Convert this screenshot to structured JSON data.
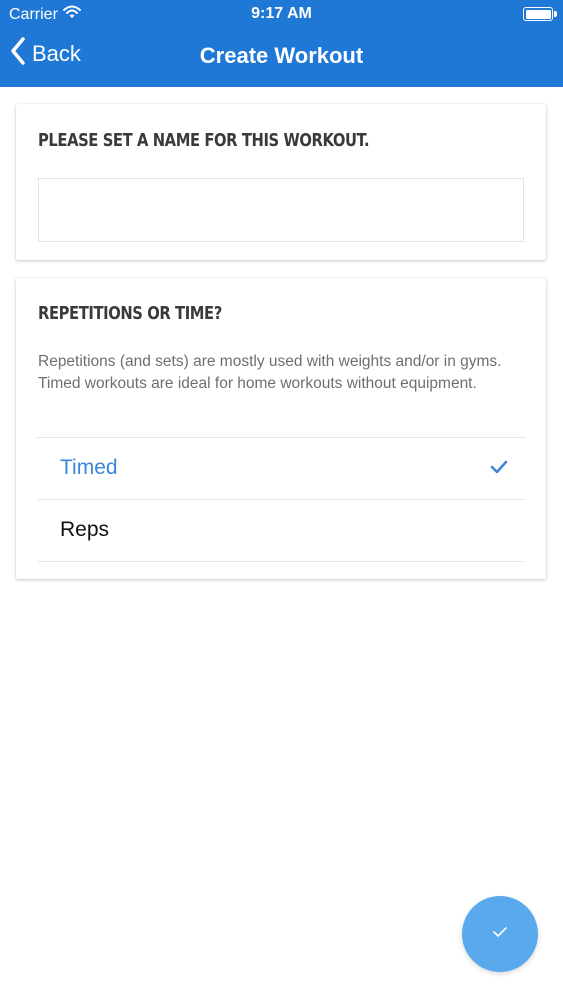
{
  "status_bar": {
    "carrier": "Carrier",
    "time": "9:17 AM",
    "icons": [
      "wifi-icon",
      "battery-icon"
    ]
  },
  "nav": {
    "back_label": "Back",
    "title": "Create Workout",
    "icons": [
      "chevron-left-icon"
    ]
  },
  "name_card": {
    "heading": "Please set a name for this workout.",
    "input_value": "",
    "input_placeholder": ""
  },
  "mode_card": {
    "heading": "Repetitions or time?",
    "description": "Repetitions (and sets) are mostly used with weights and/or in gyms. Timed workouts are ideal for home workouts without equipment.",
    "options": [
      {
        "label": "Timed",
        "selected": true
      },
      {
        "label": "Reps",
        "selected": false
      }
    ]
  },
  "fab": {
    "icon": "checkmark-icon"
  },
  "colors": {
    "header": "#1f78d6",
    "accent": "#3a86d8",
    "fab": "#5aa9ec"
  }
}
